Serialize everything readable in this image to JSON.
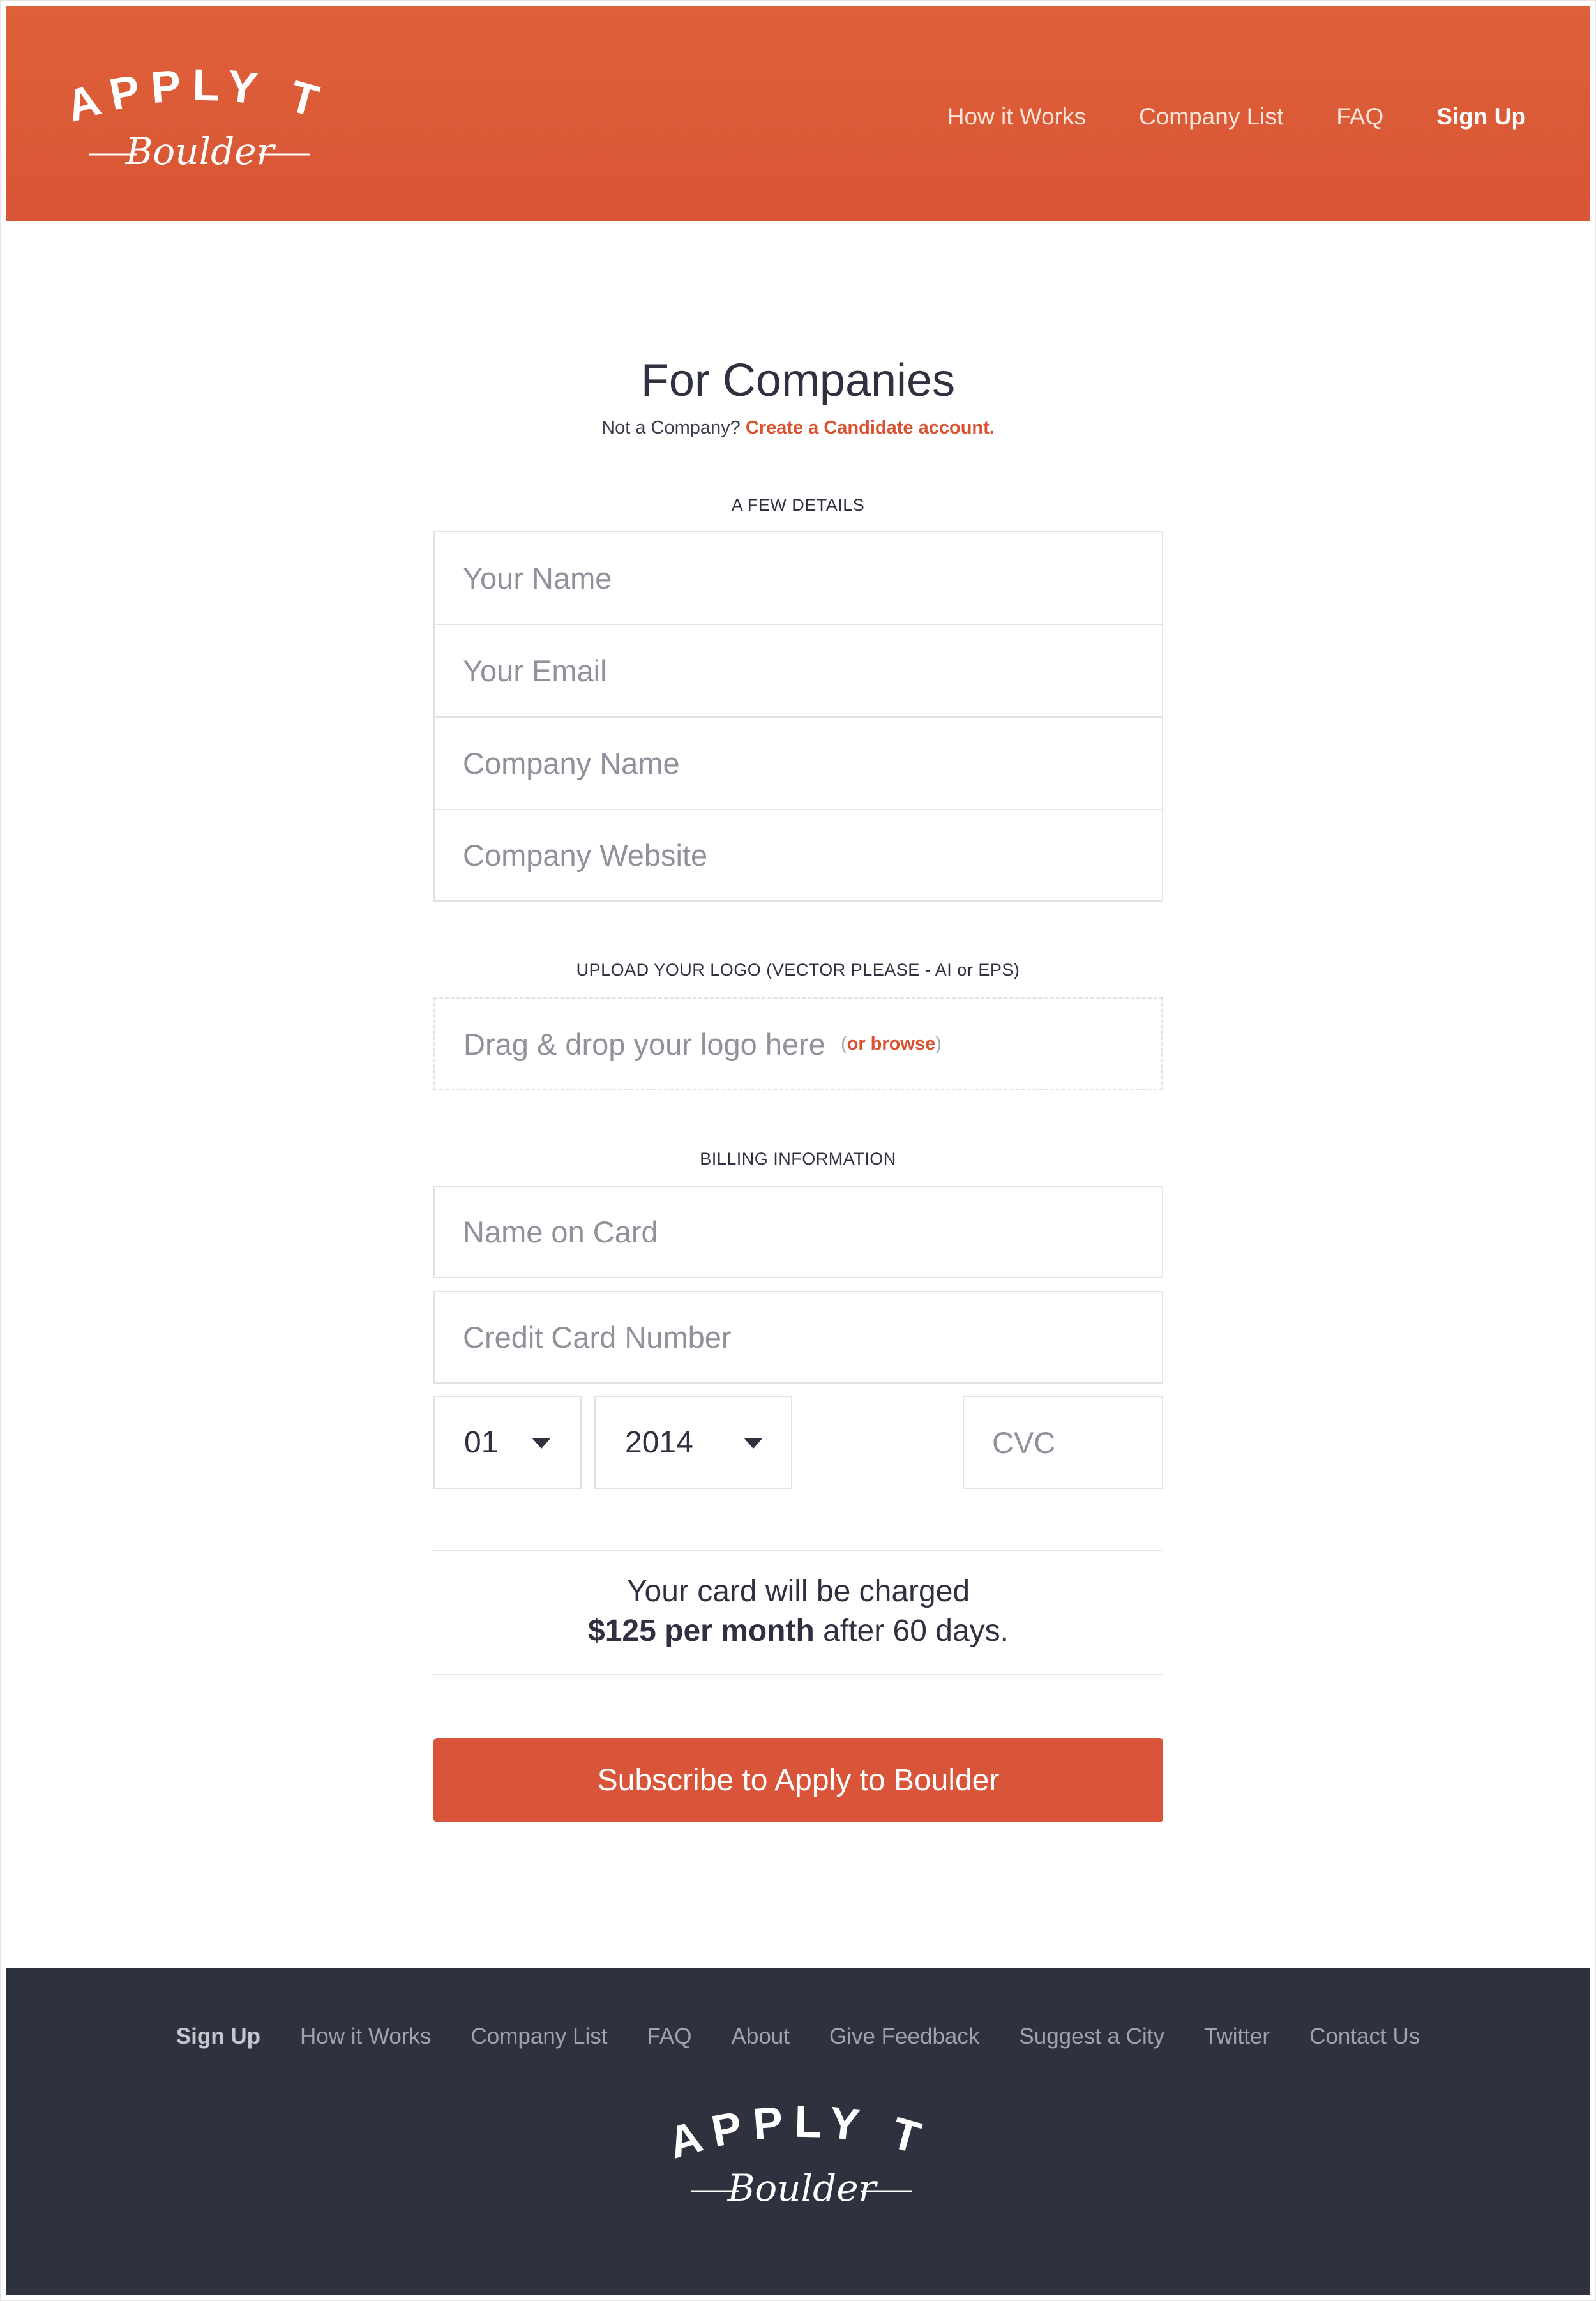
{
  "header": {
    "logo": {
      "line1": "APPLY TO",
      "line2": "Boulder"
    },
    "nav": [
      {
        "label": "How it Works"
      },
      {
        "label": "Company List"
      },
      {
        "label": "FAQ"
      },
      {
        "label": "Sign Up"
      }
    ]
  },
  "main": {
    "title": "For Companies",
    "subtitle_prefix": "Not a Company?",
    "subtitle_link": "Create a Candidate account.",
    "details_label": "A FEW DETAILS",
    "details_fields": [
      {
        "placeholder": "Your Name"
      },
      {
        "placeholder": "Your Email"
      },
      {
        "placeholder": "Company Name"
      },
      {
        "placeholder": "Company Website"
      }
    ],
    "logo_label": "UPLOAD YOUR LOGO (VECTOR PLEASE - AI or EPS)",
    "dropzone_text": "Drag & drop your logo here",
    "dropzone_browse_open": "(",
    "dropzone_browse": "or browse",
    "dropzone_browse_close": ")",
    "billing_label": "BILLING INFORMATION",
    "billing_fields": [
      {
        "placeholder": "Name on Card"
      },
      {
        "placeholder": "Credit Card Number"
      }
    ],
    "month_value": "01",
    "year_value": "2014",
    "cvc_placeholder": "CVC",
    "charge_line1": "Your card will be charged",
    "charge_amount": "$125 per month",
    "charge_suffix": "after 60 days.",
    "submit_label": "Subscribe to Apply to Boulder"
  },
  "footer": {
    "nav": [
      {
        "label": "Sign Up"
      },
      {
        "label": "How it Works"
      },
      {
        "label": "Company List"
      },
      {
        "label": "FAQ"
      },
      {
        "label": "About"
      },
      {
        "label": "Give Feedback"
      },
      {
        "label": "Suggest a City"
      },
      {
        "label": "Twitter"
      },
      {
        "label": "Contact Us"
      }
    ],
    "logo": {
      "line1": "APPLY TO",
      "line2": "Boulder"
    }
  },
  "colors": {
    "brand_orange": "#d9553a",
    "footer_bg": "#2e313e",
    "link": "#d9512f"
  }
}
